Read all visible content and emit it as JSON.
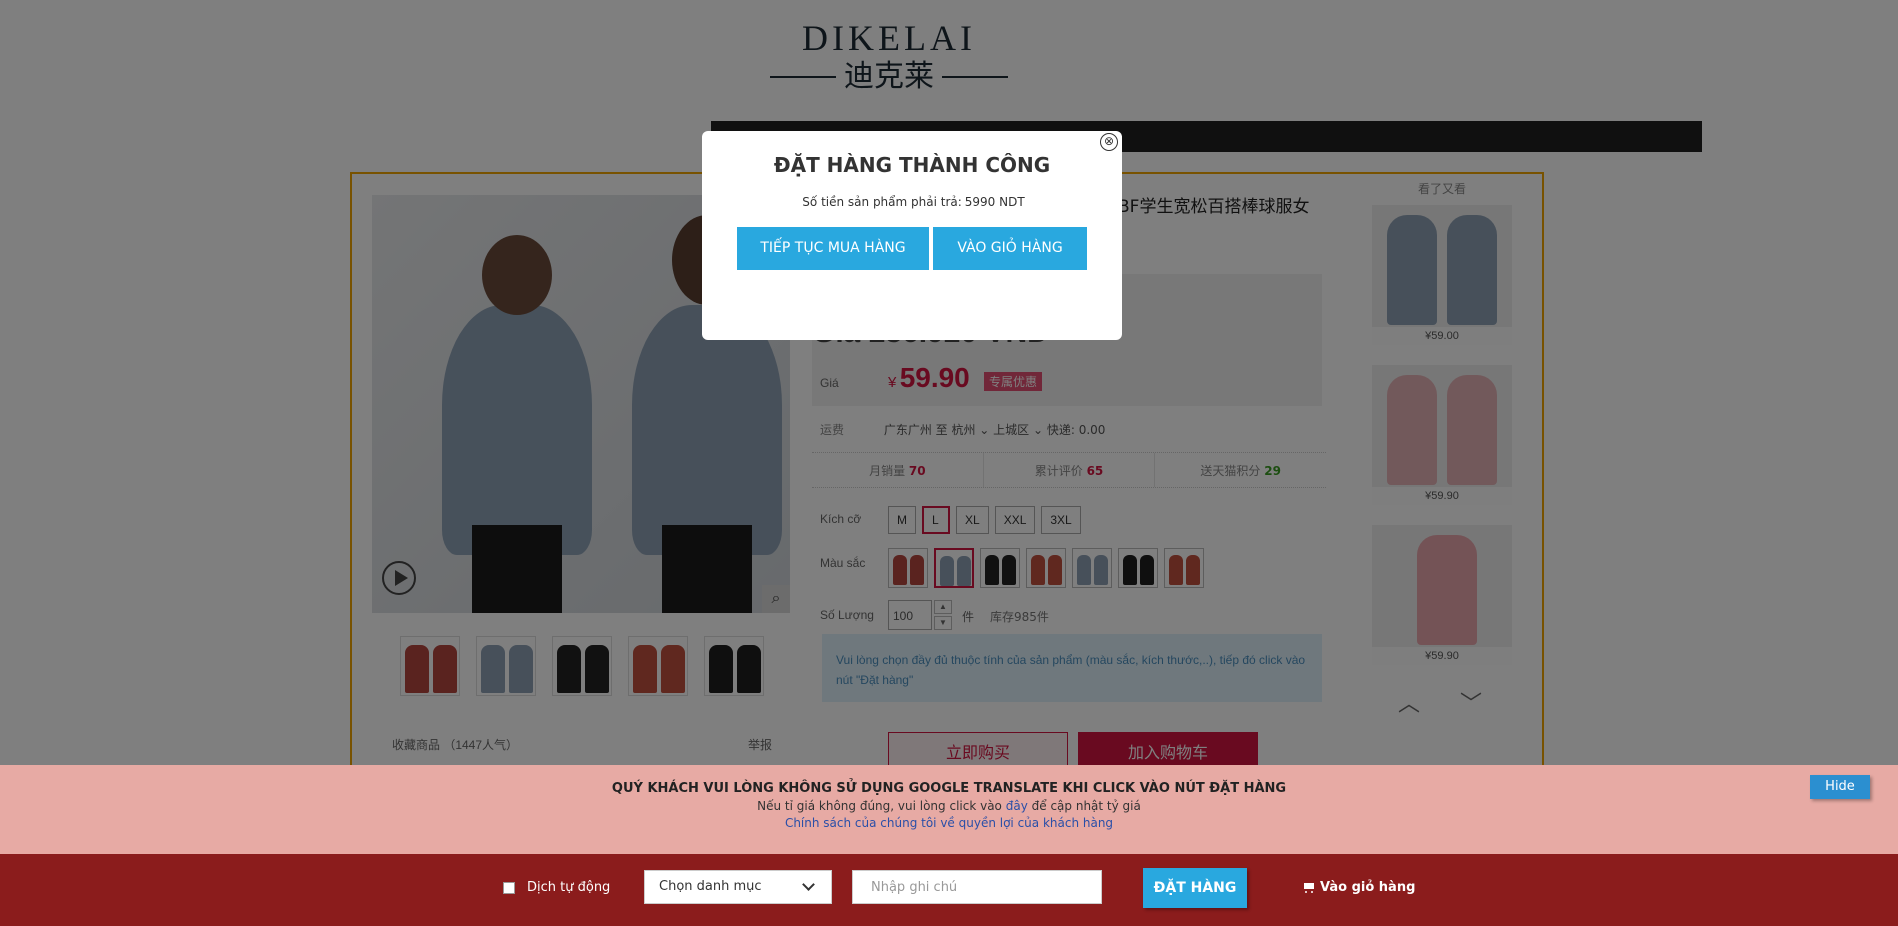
{
  "store": {
    "brand_en": "DIKELAI",
    "brand_cn": "迪克莱"
  },
  "product": {
    "title": "BF学生宽松百搭棒球服女",
    "old_price": "Giá 236.920 VND",
    "price_label": "Giá",
    "currency": "¥",
    "price": "59.90",
    "promo_tag": "专属优惠",
    "shipping_label": "运费",
    "shipping_text": "广东广州 至 杭州 ⌄ 上城区 ⌄ 快递: 0.00",
    "stats": [
      {
        "label": "月销量",
        "value": "70",
        "tone": "red"
      },
      {
        "label": "累计评价",
        "value": "65",
        "tone": "red"
      },
      {
        "label": "送天猫积分",
        "value": "29",
        "tone": "green"
      }
    ],
    "size_label": "Kích cỡ",
    "sizes": [
      "M",
      "L",
      "XL",
      "XXL",
      "3XL"
    ],
    "selected_size": "L",
    "color_label": "Màu sắc",
    "quantity_label": "Số Lượng",
    "quantity": "100",
    "quantity_unit": "件",
    "stock": "库存985件",
    "notice": "Vui lòng chọn đầy đủ thuộc tính của sản phẩm (màu sắc, kích thước,..), tiếp đó click vào nút \"Đặt hàng\"",
    "buy_now": "立即购买",
    "add_cart": "加入购物车",
    "favorite": "收藏商品 （1447人气）",
    "report": "举报"
  },
  "sidebar": {
    "heading": "看了又看",
    "items": [
      {
        "price": "¥59.00"
      },
      {
        "price": "¥59.90"
      },
      {
        "price": "¥59.90"
      }
    ]
  },
  "modal": {
    "title": "ĐẶT HÀNG THÀNH CÔNG",
    "amount_label": "Số tiền sản phẩm phải trả:",
    "amount_value": "5990 NDT",
    "continue_button": "TIẾP TỤC MUA HÀNG",
    "cart_button": "VÀO GIỎ HÀNG",
    "close_symbol": "⊗"
  },
  "warning": {
    "line1": "QUÝ KHÁCH VUI LÒNG KHÔNG SỬ DỤNG GOOGLE TRANSLATE KHI CLICK VÀO NÚT ĐẶT HÀNG",
    "line2_pre": "Nếu tỉ giá không đúng, vui lòng click vào",
    "line2_link": "đây",
    "line2_post": "để cập nhật tỷ giá",
    "line3": "Chính sách của chúng tôi về quyền lợi của khách hàng",
    "hide_button": "Hide"
  },
  "action_bar": {
    "auto_translate_label": "Dịch tự động",
    "category_select": "Chọn danh mục",
    "note_placeholder": "Nhập ghi chú",
    "order_button": "ĐẶT HÀNG",
    "cart_link": "Vào giỏ hàng"
  },
  "colors": {
    "accent_blue": "#29a8df",
    "price_red": "#d31440",
    "action_bar_bg": "#8b1c1c",
    "warning_bg": "#e7aaa4",
    "frame_orange": "#f0a400"
  }
}
